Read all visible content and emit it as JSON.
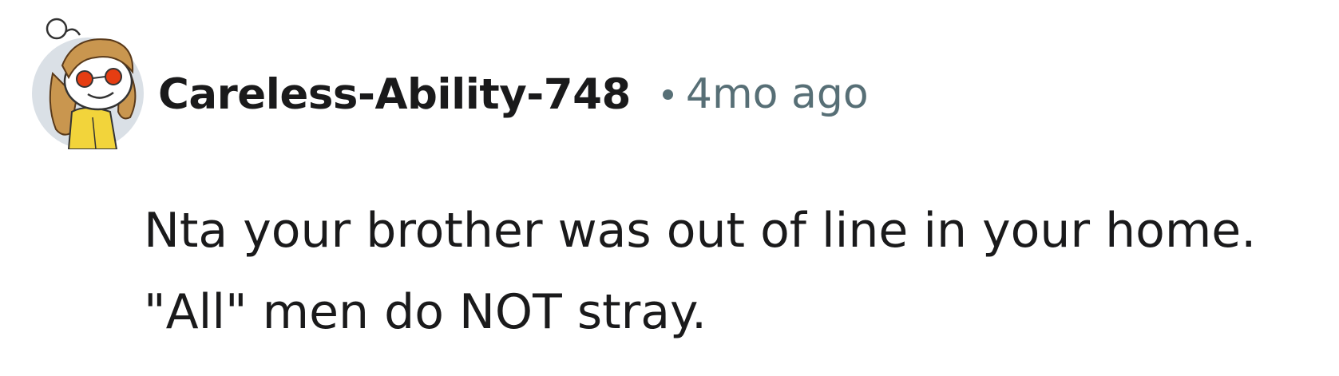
{
  "comment": {
    "author": {
      "username": "Careless-Ability-748",
      "avatar_icon": "snoo-avatar-icon"
    },
    "separator": "•",
    "timestamp": "4mo ago",
    "body": {
      "line1": "Nta your brother was out of line in your home.",
      "line2": "\"All\" men do NOT stray."
    }
  },
  "colors": {
    "text_primary": "#1a1a1b",
    "text_meta": "#576f76",
    "avatar_background": "#dae0e6",
    "avatar_hair": "#c9964f",
    "avatar_glasses_eyes": "#e53d12",
    "avatar_outfit": "#f2d43b"
  }
}
